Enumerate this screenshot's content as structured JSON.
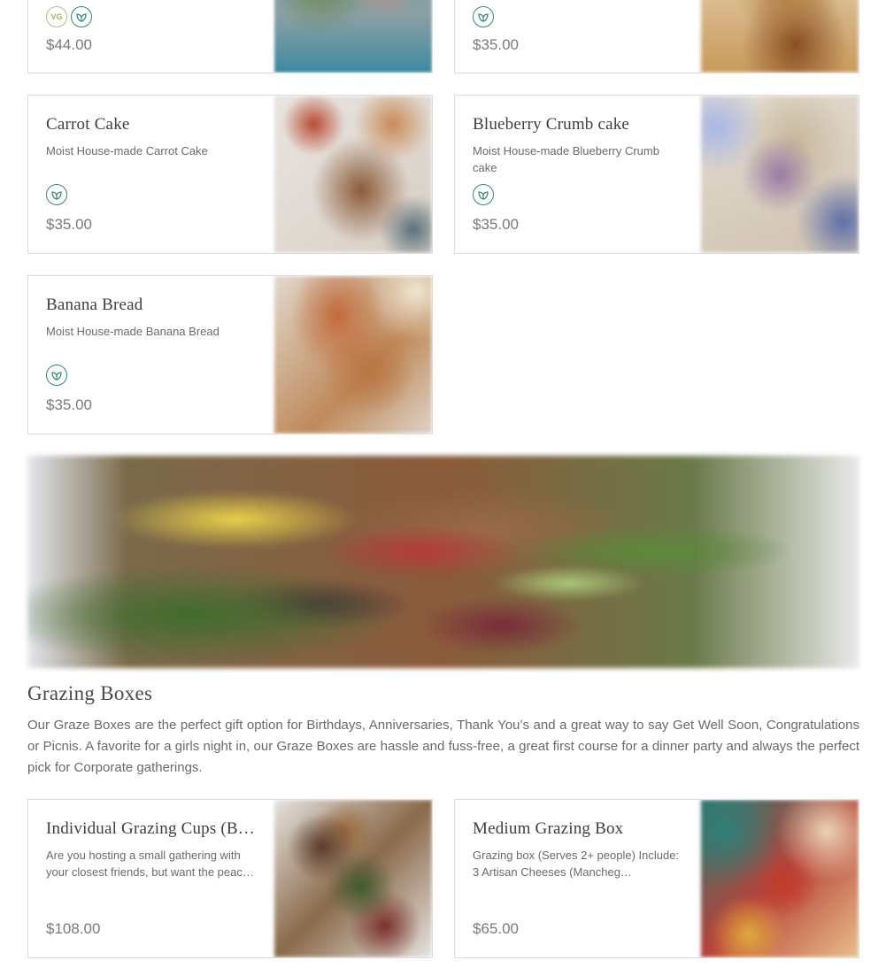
{
  "colors": {
    "veg_badge": "#2f8a68",
    "vg_badge": "#a3ad62",
    "border": "#dcdcdc"
  },
  "top_cards": [
    {
      "price": "$44.00",
      "badges": [
        "vegan-icon",
        "vegetarian-icon"
      ],
      "vegan_label": "VG"
    },
    {
      "price": "$35.00",
      "badges": [
        "vegetarian-icon"
      ]
    }
  ],
  "cards": [
    {
      "title": "Carrot Cake",
      "description": "Moist House-made Carrot Cake",
      "price": "$35.00",
      "badges": [
        "vegetarian-icon"
      ]
    },
    {
      "title": "Blueberry Crumb cake",
      "description": "Moist House-made Blueberry Crumb cake",
      "price": "$35.00",
      "badges": [
        "vegetarian-icon"
      ]
    },
    {
      "title": "Banana Bread",
      "description": "Moist House-made Banana Bread",
      "price": "$35.00",
      "badges": [
        "vegetarian-icon"
      ]
    }
  ],
  "section": {
    "title": "Grazing Boxes",
    "description": "Our Graze Boxes are the perfect gift option for Birthdays, Anniversaries, Thank You’s and a great way to say Get Well Soon, Congratulations or Picnis. A favorite for a girls night in, our Graze Boxes are hassle and fuss-free, a great first course for a dinner party and always the perfect pick for Corporate gatherings."
  },
  "grazing_cards": [
    {
      "title": "Individual Grazing Cups (B…",
      "description": "Are you hosting a small gathering with your closest friends, but want the peac…",
      "price": "$108.00"
    },
    {
      "title": "Medium Grazing Box",
      "description": "Grazing box (Serves 2+ people) Include: 3 Artisan Cheeses (Mancheg…",
      "price": "$65.00"
    }
  ]
}
